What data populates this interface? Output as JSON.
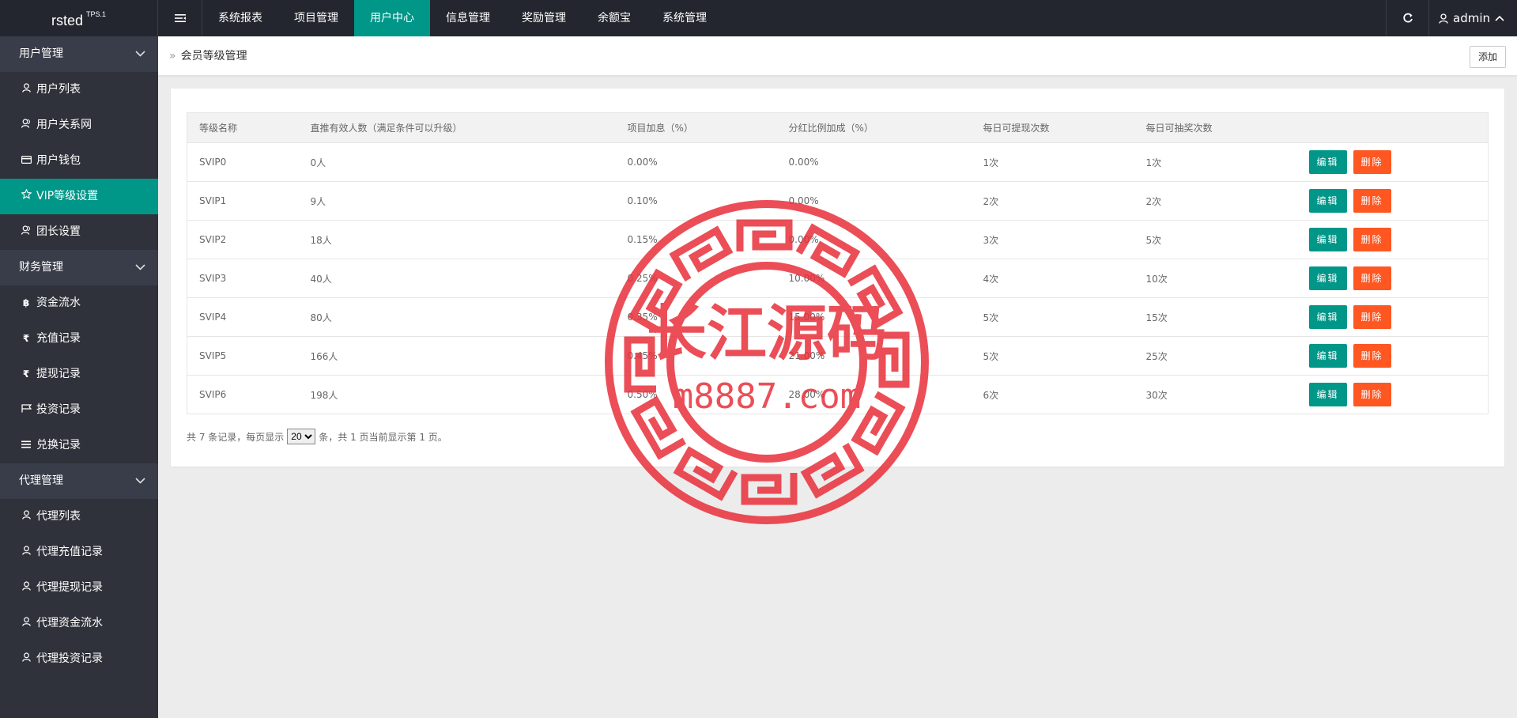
{
  "header": {
    "logo": "rsted",
    "logo_sup": "TPS.1",
    "nav": [
      {
        "label": "系统报表",
        "active": false
      },
      {
        "label": "项目管理",
        "active": false
      },
      {
        "label": "用户中心",
        "active": true
      },
      {
        "label": "信息管理",
        "active": false
      },
      {
        "label": "奖励管理",
        "active": false
      },
      {
        "label": "余额宝",
        "active": false
      },
      {
        "label": "系统管理",
        "active": false
      }
    ],
    "user": "admin"
  },
  "sidebar": {
    "groups": [
      {
        "label": "用户管理",
        "items": [
          {
            "label": "用户列表",
            "icon": "user-icon",
            "active": false
          },
          {
            "label": "用户关系网",
            "icon": "users-icon",
            "active": false
          },
          {
            "label": "用户钱包",
            "icon": "credit-card-icon",
            "active": false
          },
          {
            "label": "VIP等级设置",
            "icon": "star-icon",
            "active": true
          },
          {
            "label": "团长设置",
            "icon": "users-icon",
            "active": false
          }
        ]
      },
      {
        "label": "财务管理",
        "items": [
          {
            "label": "资金流水",
            "icon": "bitcoin-icon",
            "active": false
          },
          {
            "label": "充值记录",
            "icon": "rupee-icon",
            "active": false
          },
          {
            "label": "提现记录",
            "icon": "rupee-icon",
            "active": false
          },
          {
            "label": "投资记录",
            "icon": "flag-icon",
            "active": false
          },
          {
            "label": "兑换记录",
            "icon": "list-icon",
            "active": false
          }
        ]
      },
      {
        "label": "代理管理",
        "items": [
          {
            "label": "代理列表",
            "icon": "user-icon",
            "active": false
          },
          {
            "label": "代理充值记录",
            "icon": "user-icon",
            "active": false
          },
          {
            "label": "代理提现记录",
            "icon": "user-icon",
            "active": false
          },
          {
            "label": "代理资金流水",
            "icon": "user-icon",
            "active": false
          },
          {
            "label": "代理投资记录",
            "icon": "user-icon",
            "active": false
          }
        ]
      }
    ]
  },
  "page": {
    "breadcrumb": "会员等级管理",
    "add_label": "添加"
  },
  "table": {
    "columns": [
      "等级名称",
      "直推有效人数（满足条件可以升级）",
      "项目加息（%）",
      "分红比例加成（%）",
      "每日可提现次数",
      "每日可抽奖次数",
      ""
    ],
    "edit_label": "编辑",
    "delete_label": "删除",
    "rows": [
      [
        "SVIP0",
        "0人",
        "0.00%",
        "0.00%",
        "1次",
        "1次"
      ],
      [
        "SVIP1",
        "9人",
        "0.10%",
        "0.00%",
        "2次",
        "2次"
      ],
      [
        "SVIP2",
        "18人",
        "0.15%",
        "0.00%",
        "3次",
        "5次"
      ],
      [
        "SVIP3",
        "40人",
        "0.25%",
        "10.00%",
        "4次",
        "10次"
      ],
      [
        "SVIP4",
        "80人",
        "0.35%",
        "15.00%",
        "5次",
        "15次"
      ],
      [
        "SVIP5",
        "166人",
        "0.45%",
        "21.00%",
        "5次",
        "25次"
      ],
      [
        "SVIP6",
        "198人",
        "0.50%",
        "28.00%",
        "6次",
        "30次"
      ]
    ]
  },
  "pager": {
    "prefix": "共 7 条记录，每页显示",
    "page_size": "20",
    "suffix": "条，共 1 页当前显示第 1 页。"
  },
  "watermark": {
    "title": "长江源码",
    "url": "m8887.com",
    "color": "#e8303a"
  },
  "colors": {
    "accent": "#009688",
    "danger": "#ff5722",
    "header_bg": "#23262e",
    "sidebar_bg": "#2f323a"
  }
}
